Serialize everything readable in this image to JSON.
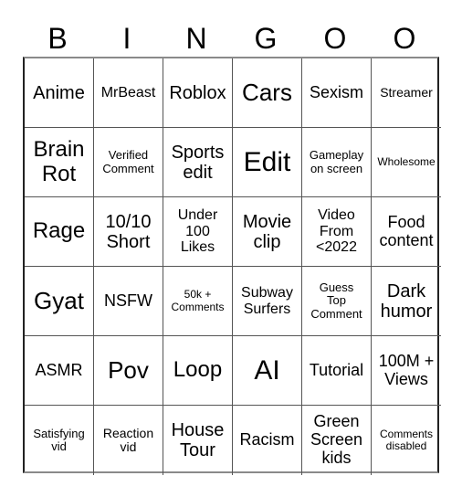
{
  "header": {
    "letters": [
      "B",
      "I",
      "N",
      "G",
      "O",
      "O"
    ]
  },
  "cells": [
    "Anime",
    "MrBeast",
    "Roblox",
    "Cars",
    "Sexism",
    "Streamer",
    "Brain\nRot",
    "Verified\nComment",
    "Sports\nedit",
    "Edit",
    "Gameplay\non screen",
    "Wholesome",
    "Rage",
    "10/10\nShort",
    "Under\n100\nLikes",
    "Movie\nclip",
    "Video\nFrom\n<2022",
    "Food\ncontent",
    "Gyat",
    "NSFW",
    "50k +\nComments",
    "Subway\nSurfers",
    "Guess\nTop\nComment",
    "Dark\nhumor",
    "ASMR",
    "Pov",
    "Loop",
    "AI",
    "Tutorial",
    "100M +\nViews",
    "Satisfying\nvid",
    "Reaction\nvid",
    "House\nTour",
    "Racism",
    "Green\nScreen\nkids",
    "Comments\ndisabled"
  ]
}
